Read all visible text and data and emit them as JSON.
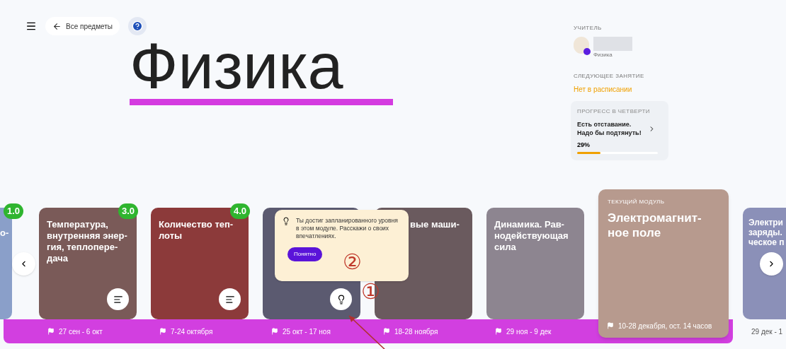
{
  "top_bar": {
    "back_button": "Все предметы"
  },
  "title": "Физика",
  "teacher": {
    "label": "УЧИТЕЛЬ",
    "subject": "Физика"
  },
  "next_lesson": {
    "label": "СЛЕДУЮЩЕЕ ЗАНЯТИЕ",
    "value": "Нет в расписании"
  },
  "progress": {
    "label": "ПРОГРЕСС В ЧЕТВЕРТИ",
    "message": "Есть отставание. Надо бы подтянуть!",
    "percent": "29%",
    "level": 0.29
  },
  "modules": [
    {
      "kind": "partial_left",
      "title": "о-",
      "grade": "1.0"
    },
    {
      "kind": "module",
      "title": "Температура, внутренняя энер-гия, теплопере-дача",
      "grade": "3.0",
      "date": "27 сен - 6 окт",
      "button": {
        "kind": "notes"
      }
    },
    {
      "kind": "module",
      "title": "Количество теп-лоты",
      "grade": "4.0",
      "date": "7-24 октября",
      "button": {
        "kind": "notes"
      }
    },
    {
      "kind": "module",
      "date": "25 окт - 17 ноя",
      "button": {
        "kind": "hint"
      }
    },
    {
      "kind": "module_under_tooltip",
      "title": "вые маши-",
      "date": "18-28 ноября"
    },
    {
      "kind": "module",
      "title": "Динамика. Рав-нодействующая сила",
      "date": "29 ноя - 9 дек"
    },
    {
      "kind": "current",
      "label": "ТЕКУЩИЙ МОДУЛЬ",
      "title": "Электромагнит-ное поле",
      "date": "10-28 декабря, ост. 14 часов"
    },
    {
      "kind": "partial_right",
      "title": "Электри заряды. ческое п",
      "date": "29 дек - 1"
    }
  ],
  "tooltip": {
    "text": "Ты достиг запланированного уровня в этом модуле. Расскажи о своих впечатлениях.",
    "button": "Понятно"
  },
  "annotations": [
    "②",
    "①"
  ]
}
